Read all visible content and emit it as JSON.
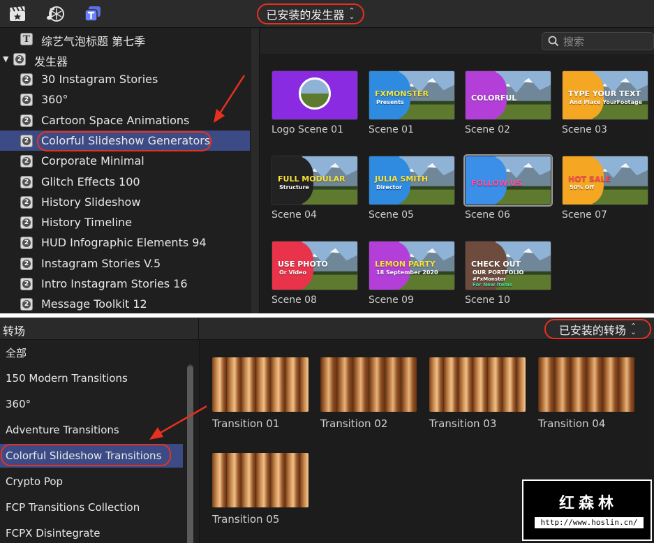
{
  "generators_panel": {
    "toolbar_icons": [
      "clapper-icon",
      "music-photos-icon",
      "titles-generators-icon"
    ],
    "popup_label": "已安装的发生器",
    "search_placeholder": "搜索",
    "sidebar": {
      "top_item": "综艺气泡标题 第七季",
      "group_label": "发生器",
      "items": [
        "30 Instagram Stories",
        "360°",
        "Cartoon Space Animations",
        "Colorful Slideshow Generators",
        "Corporate Minimal",
        "Glitch Effects 100",
        "History Slideshow",
        "History Timeline",
        "HUD Infographic Elements 94",
        "Instagram Stories V.5",
        "Intro Instagram Stories 16",
        "Message Toolkit 12"
      ],
      "selected": "Colorful Slideshow Generators"
    },
    "thumbnails": [
      {
        "caption": "Logo Scene 01",
        "text": "",
        "color": "#8a2be2"
      },
      {
        "caption": "Scene 01",
        "text": "FXMONSTER",
        "sub": "Presents",
        "color": "#2f8be0"
      },
      {
        "caption": "Scene 02",
        "text": "COLORFUL",
        "color": "#b33fd8"
      },
      {
        "caption": "Scene 03",
        "text": "TYPE YOUR TEXT",
        "sub": "And Place YourFootage",
        "color": "#f5a623"
      },
      {
        "caption": "Scene 04",
        "text": "FULL MODULAR",
        "sub": "Structure",
        "color": "#222222"
      },
      {
        "caption": "Scene 05",
        "text": "JULIA SMITH",
        "sub": "Director",
        "color": "#2f8be0"
      },
      {
        "caption": "Scene 06",
        "text": "FOLLOW US",
        "color": "#3c8fe8"
      },
      {
        "caption": "Scene 07",
        "text": "HOT SALE",
        "sub": "50% Off",
        "color": "#f5a623"
      },
      {
        "caption": "Scene 08",
        "text": "USE PHOTO",
        "sub": "Or Video",
        "color": "#e8334a"
      },
      {
        "caption": "Scene 09",
        "text": "LEMON PARTY",
        "sub": "18 September 2020",
        "color": "#b33fd8"
      },
      {
        "caption": "Scene 10",
        "text": "CHECK OUT",
        "sub": "OUR PORTFOLIO",
        "sub2": "#FxMonster",
        "sub3": "For New Items",
        "color": "#6d4c3d"
      }
    ],
    "selected_thumbnail": "Scene 06"
  },
  "transitions_panel": {
    "title": "转场",
    "popup_label": "已安装的转场",
    "sidebar": {
      "items": [
        "全部",
        "150 Modern Transitions",
        "360°",
        "Adventure Transitions",
        "Colorful Slideshow Transitions",
        "Crypto Pop",
        "FCP Transitions Collection",
        "FCPX Disintegrate"
      ],
      "selected": "Colorful Slideshow Transitions"
    },
    "thumbnails": [
      {
        "caption": "Transition 01"
      },
      {
        "caption": "Transition 02"
      },
      {
        "caption": "Transition 03"
      },
      {
        "caption": "Transition 04"
      },
      {
        "caption": "Transition 05"
      }
    ]
  },
  "watermark": {
    "name": "红森林",
    "url": "http://www.hoslin.cn/"
  },
  "colors": {
    "accent_selection": "#3c4b85",
    "annotation_red": "#e8301f"
  }
}
